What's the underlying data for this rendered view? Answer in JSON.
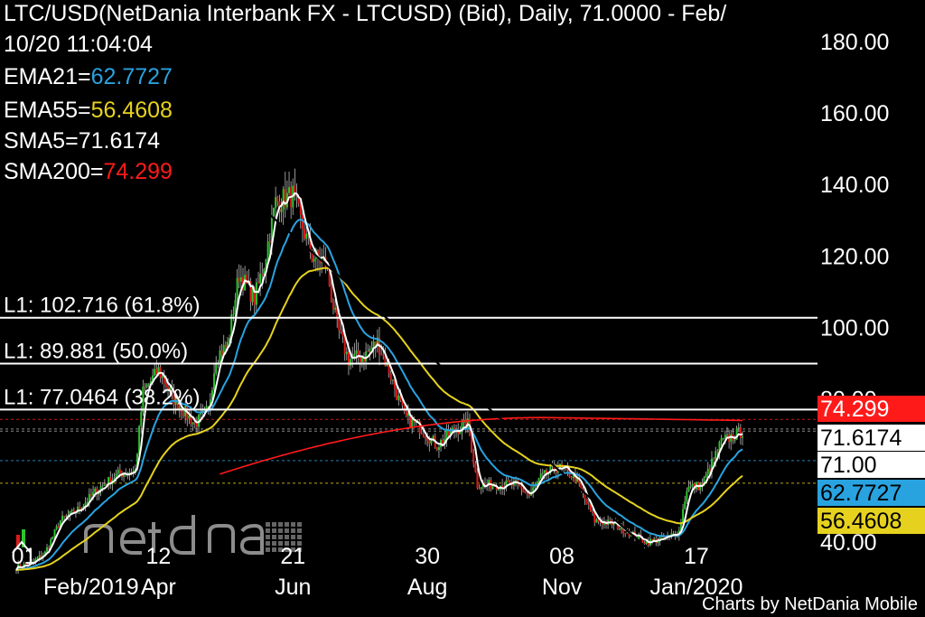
{
  "chart_data": {
    "type": "candlestick",
    "title": "LTC/USD(NetDania Interbank FX - LTCUSD) (Bid),  Daily, 71.0000 - Feb/",
    "subtitle": "10/20 11:04:04",
    "indicators": [
      {
        "name": "EMA21",
        "label": "EMA21=",
        "value": "62.7727",
        "color": "#29a3e0"
      },
      {
        "name": "EMA55",
        "label": "EMA55=",
        "value": "56.4608",
        "color": "#e6d21e"
      },
      {
        "name": "SMA5",
        "label": "SMA5=",
        "value": "71.6174",
        "color": "#ffffff"
      },
      {
        "name": "SMA200",
        "label": "SMA200=",
        "value": "74.299",
        "color": "#ff1a1a"
      }
    ],
    "y_ticks": [
      "40.00",
      "80.00",
      "100.00",
      "120.00",
      "140.00",
      "160.00",
      "180.00"
    ],
    "y_tick_values": [
      40,
      80,
      100,
      120,
      140,
      160,
      180
    ],
    "ylim": [
      40,
      184
    ],
    "x_ticks": [
      {
        "day": "01",
        "month": "Feb/2019",
        "date": "2019-02-01"
      },
      {
        "day": "12",
        "month": "Apr",
        "date": "2019-04-12"
      },
      {
        "day": "21",
        "month": "Jun",
        "date": "2019-06-21"
      },
      {
        "day": "30",
        "month": "Aug",
        "date": "2019-08-30"
      },
      {
        "day": "08",
        "month": "Nov",
        "date": "2019-11-08"
      },
      {
        "day": "17",
        "month": "Jan/2020",
        "date": "2020-01-17"
      }
    ],
    "xlim": [
      "2019-01-28",
      "2020-02-10"
    ],
    "fib_levels": [
      {
        "label": "L1: 102.716 (61.8%)",
        "value": 102.716
      },
      {
        "label": "L1: 89.881 (50.0%)",
        "value": 89.881
      },
      {
        "label": "L1: 77.0464 (38.2%)",
        "value": 77.0464
      }
    ],
    "trend_line": {
      "label": "L1",
      "from": [
        "2019-02-10",
        188
      ],
      "to": [
        "2019-12-25",
        37
      ]
    },
    "price_tags": [
      {
        "text": "74.299",
        "value": 74.299,
        "bg": "#ff1a1a",
        "fg": "#ffffff"
      },
      {
        "text": "71.6174",
        "value": 71.6174,
        "bg": "#ffffff",
        "fg": "#000000"
      },
      {
        "text": "71.00",
        "value": 71.0,
        "bg": "#ffffff",
        "fg": "#000000"
      },
      {
        "text": "62.7727",
        "value": 62.7727,
        "bg": "#29a3e0",
        "fg": "#000000"
      },
      {
        "text": "56.4608",
        "value": 56.4608,
        "bg": "#e6d21e",
        "fg": "#000000"
      }
    ],
    "price_anchors": [
      [
        "2019-01-28",
        33
      ],
      [
        "2019-02-05",
        34
      ],
      [
        "2019-02-12",
        37
      ],
      [
        "2019-02-20",
        46
      ],
      [
        "2019-03-01",
        49
      ],
      [
        "2019-03-12",
        55
      ],
      [
        "2019-03-22",
        59
      ],
      [
        "2019-03-31",
        60
      ],
      [
        "2019-04-04",
        82
      ],
      [
        "2019-04-12",
        88
      ],
      [
        "2019-04-20",
        80
      ],
      [
        "2019-05-01",
        73
      ],
      [
        "2019-05-08",
        77
      ],
      [
        "2019-05-12",
        92
      ],
      [
        "2019-05-18",
        95
      ],
      [
        "2019-05-24",
        115
      ],
      [
        "2019-06-01",
        108
      ],
      [
        "2019-06-06",
        118
      ],
      [
        "2019-06-12",
        135
      ],
      [
        "2019-06-21",
        137
      ],
      [
        "2019-06-26",
        128
      ],
      [
        "2019-07-01",
        120
      ],
      [
        "2019-07-08",
        118
      ],
      [
        "2019-07-14",
        100
      ],
      [
        "2019-07-20",
        91
      ],
      [
        "2019-07-28",
        92
      ],
      [
        "2019-08-04",
        96
      ],
      [
        "2019-08-10",
        88
      ],
      [
        "2019-08-18",
        75
      ],
      [
        "2019-08-26",
        72
      ],
      [
        "2019-09-04",
        67
      ],
      [
        "2019-09-12",
        71
      ],
      [
        "2019-09-20",
        73
      ],
      [
        "2019-09-25",
        56
      ],
      [
        "2019-10-05",
        56
      ],
      [
        "2019-10-15",
        56
      ],
      [
        "2019-10-22",
        53
      ],
      [
        "2019-10-28",
        58
      ],
      [
        "2019-11-06",
        61
      ],
      [
        "2019-11-15",
        58
      ],
      [
        "2019-11-25",
        46
      ],
      [
        "2019-12-05",
        45
      ],
      [
        "2019-12-15",
        42
      ],
      [
        "2019-12-22",
        40
      ],
      [
        "2020-01-01",
        41
      ],
      [
        "2020-01-08",
        43
      ],
      [
        "2020-01-12",
        55
      ],
      [
        "2020-01-20",
        56
      ],
      [
        "2020-01-30",
        68
      ],
      [
        "2020-02-10",
        71
      ]
    ]
  },
  "credit": "Charts by NetDania Mobile"
}
